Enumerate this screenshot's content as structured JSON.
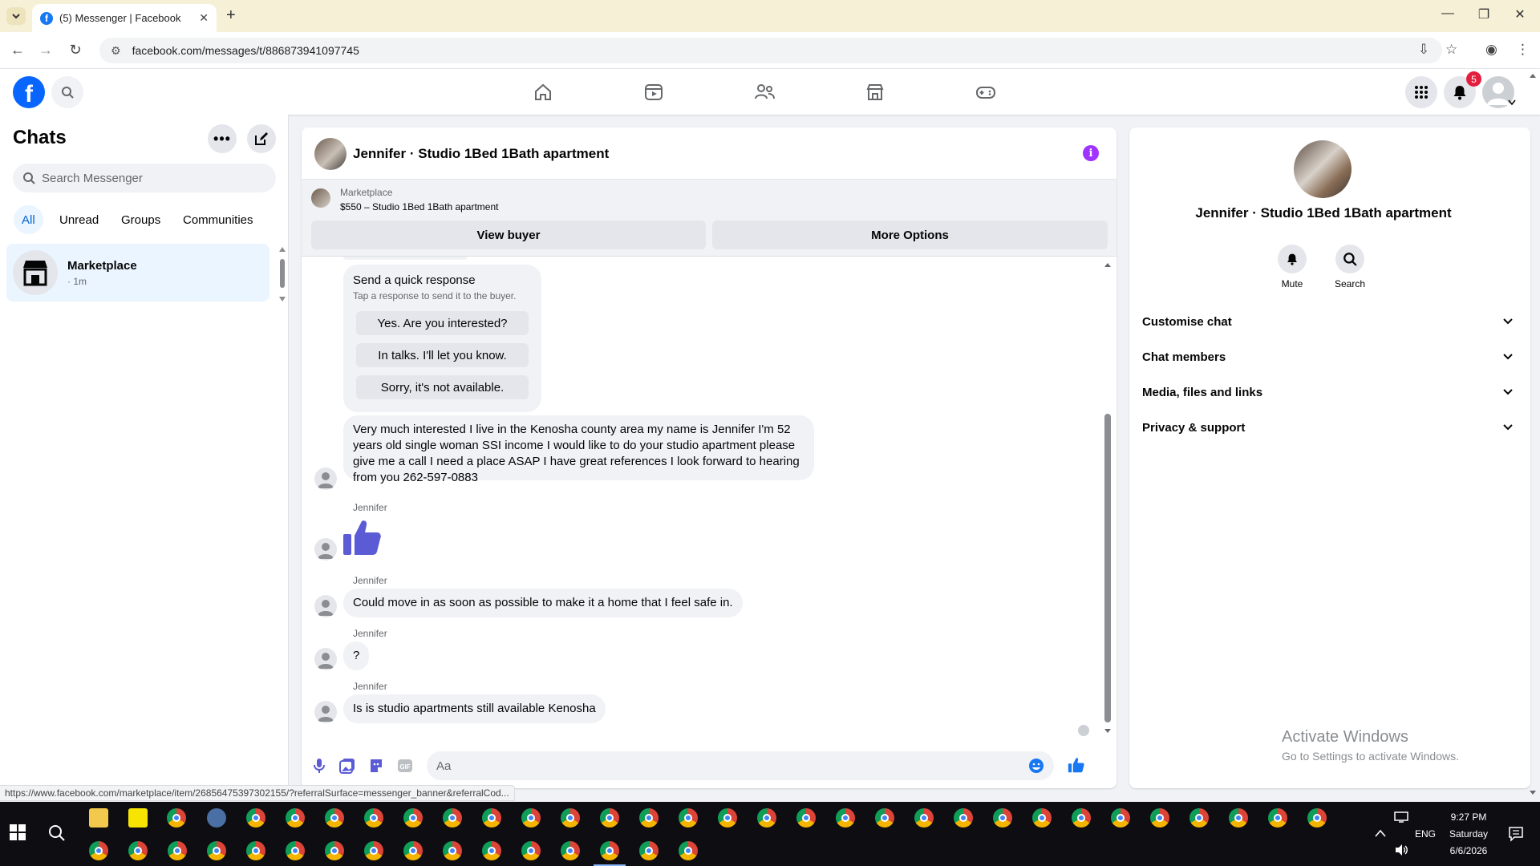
{
  "browser": {
    "tab_title": "(5) Messenger | Facebook",
    "url": "facebook.com/messages/t/886873941097745",
    "status_url": "https://www.facebook.com/marketplace/item/2685647539730​2155/?referralSurface=messenger_banner&referralCod..."
  },
  "header": {
    "notification_count": "5"
  },
  "sidebar": {
    "title": "Chats",
    "search_placeholder": "Search Messenger",
    "filters": [
      "All",
      "Unread",
      "Groups",
      "Communities"
    ],
    "chat": {
      "name": "Marketplace",
      "sub": "· 1m"
    }
  },
  "conversation": {
    "title": "Jennifer · Studio 1Bed 1Bath apartment",
    "marketplace": {
      "label": "Marketplace",
      "item": "$550 – Studio 1Bed 1Bath apartment",
      "view_buyer": "View buyer",
      "more_options": "More Options"
    },
    "quick_response": {
      "title": "Send a quick response",
      "subtitle": "Tap a response to send it to the buyer.",
      "options": [
        "Yes. Are you interested?",
        "In talks. I'll let you know.",
        "Sorry, it's not available."
      ]
    },
    "messages": {
      "m1": "Very much interested I live in the Kenosha county area my name is Jennifer I'm 52 years old single woman SSI income I would like to do your studio apartment please give me a call I need a place ASAP I have great references I look forward to hearing from you 262-597-0883",
      "sender": "Jennifer",
      "m3": "Could move in as soon as possible to make it a home that I feel safe in.",
      "m4": "?",
      "m5": "Is is studio apartments still available Kenosha"
    },
    "composer_placeholder": "Aa"
  },
  "info_panel": {
    "name": "Jennifer · Studio 1Bed 1Bath apartment",
    "mute": "Mute",
    "search": "Search",
    "sections": [
      "Customise chat",
      "Chat members",
      "Media, files and links",
      "Privacy & support"
    ]
  },
  "watermark": {
    "line1": "Activate Windows",
    "line2": "Go to Settings to activate Windows."
  },
  "taskbar": {
    "time": "9:27 PM",
    "day": "Saturday",
    "date": "6/6/2026",
    "lang": "ENG"
  },
  "colors": {
    "fb_blue": "#0866ff",
    "messenger_accent": "#a033ff",
    "like_color": "#5b5bd6",
    "badge_red": "#e41e3f"
  }
}
